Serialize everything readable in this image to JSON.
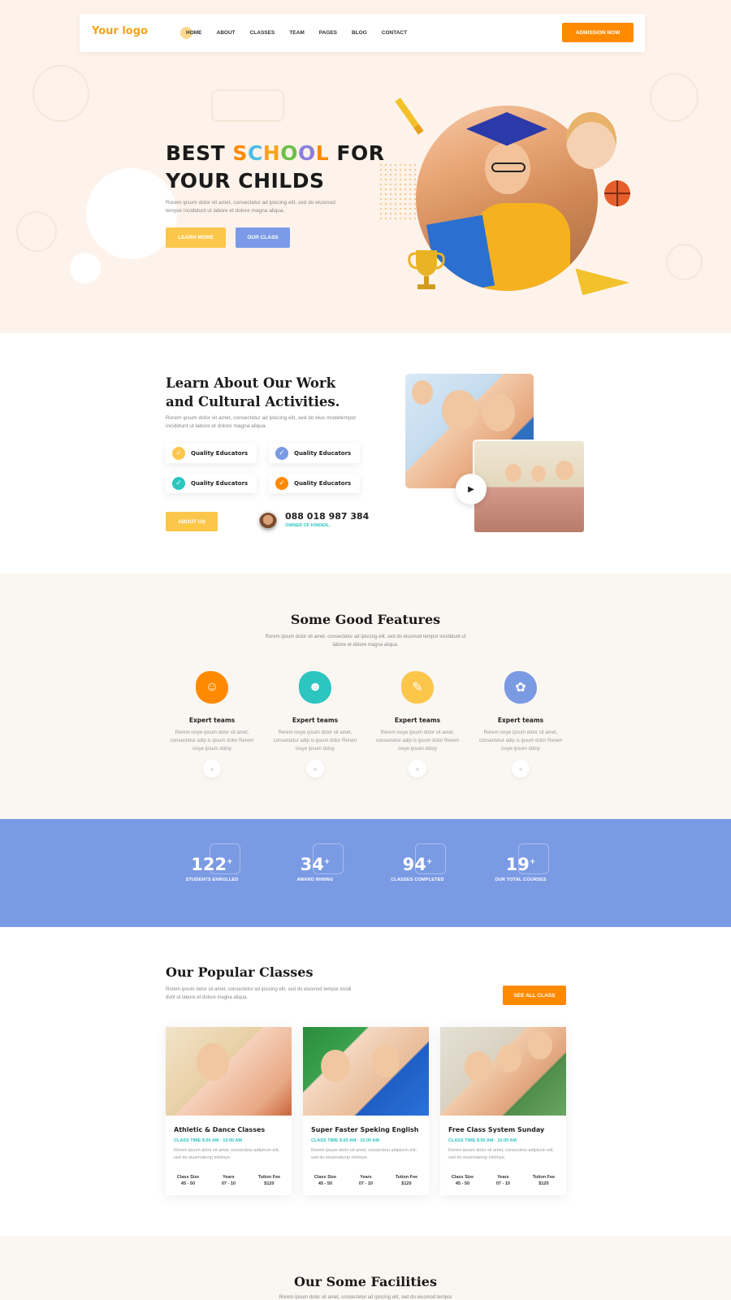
{
  "header": {
    "logo": "Your logo",
    "nav": [
      "HOME",
      "ABOUT",
      "CLASSES",
      "TEAM",
      "PAGES",
      "BLOG",
      "CONTACT"
    ],
    "admission_button": "ADMISSION NOW"
  },
  "hero": {
    "title_best": "BEST",
    "title_school": [
      "S",
      "C",
      "H",
      "O",
      "O",
      "L"
    ],
    "title_for": "FOR",
    "title_line2": "YOUR CHILDS",
    "description": "Rorem ipsum dolor sit amet, consectetur ad ipiscing elit, sed do eiusmod tempor incididunt ut labore et dolore magna aliqua.",
    "learn_more": "LEARN MORE",
    "our_class": "OUR CLASS"
  },
  "about": {
    "title": "Learn About Our Work and Cultural Activities.",
    "description": "Rorem ipsum dolor sit amet, consectetur ad ipiscing elit, sed do eius modetempor incididunt ut labore et dolore magna aliqua.",
    "qualities": [
      "Quality Educators",
      "Quality Educators",
      "Quality Educators",
      "Quality Educators"
    ],
    "check": "✓",
    "about_button": "ABOUT US",
    "phone": "088 018 987 384",
    "owner_role": "OWNER OF KINDEN..",
    "play": "▶"
  },
  "features": {
    "title": "Some Good Features",
    "subtitle": "Rorem ipsum dolor sit amet, consectetur ad ipiscing elit, sed do eiusmod tempor incididunt ut labore et dolore magna aliqua.",
    "items": [
      {
        "title": "Expert teams",
        "desc": "Rerem iosye ipsum dolor sit amet, consectetur adip is ipsum dolor Rerem iosye ipsum doloy",
        "icon": "graduate-icon",
        "color": "#ff8a00"
      },
      {
        "title": "Expert teams",
        "desc": "Rerem iosye ipsum dolor sit amet, consectetur adip is ipsum dolor Rerem iosye ipsum doloy",
        "icon": "mask-icon",
        "color": "#2cc5c0"
      },
      {
        "title": "Expert teams",
        "desc": "Rerem iosye ipsum dolor sit amet, consectetur adip is ipsum dolor Rerem iosye ipsum doloy",
        "icon": "tools-icon",
        "color": "#fcc64b"
      },
      {
        "title": "Expert teams",
        "desc": "Rerem iosye ipsum dolor sit amet, consectetur adip is ipsum dolor Rerem iosye ipsum doloy",
        "icon": "palette-icon",
        "color": "#7b9ae4"
      }
    ],
    "arrow": "»"
  },
  "stats": [
    {
      "number": "122",
      "suffix": "+",
      "label": "STUDENTS ENROLLED"
    },
    {
      "number": "34",
      "suffix": "+",
      "label": "AWARD WINING"
    },
    {
      "number": "94",
      "suffix": "+",
      "label": "CLASSES COMPLETED"
    },
    {
      "number": "19",
      "suffix": "+",
      "label": "OUR TOTAL COURSES"
    }
  ],
  "classes": {
    "title": "Our Popular Classes",
    "description": "Rorem ipsum dolor sit amet, consectetur ad ipiscing elit, sed do eiusmod tempor incidi dunt ut labore et dolore magna aliqua.",
    "see_all": "SEE ALL CLASS",
    "cards": [
      {
        "title": "Athletic & Dance Classes",
        "time": "CLASS TIME 8.00 AM - 10.00 AM",
        "desc": "Rorem ipsum dolor sit amet, consectetu adipiscin elit, sed do eiusmotemp mirimye.",
        "size_label": "Class Size",
        "size": "45 - 50",
        "years_label": "Years",
        "years": "07 - 10",
        "fee_label": "Tution Fee",
        "fee": "$120"
      },
      {
        "title": "Super Faster Speking English",
        "time": "CLASS TIME 8.00 AM - 10.00 AM",
        "desc": "Rorem ipsum dolor sit amet, consectetu adipiscin elit, sed do eiusmotemp mirimye.",
        "size_label": "Class Size",
        "size": "45 - 50",
        "years_label": "Years",
        "years": "07 - 10",
        "fee_label": "Tution Fee",
        "fee": "$120"
      },
      {
        "title": "Free Class System Sunday",
        "time": "CLASS TIME 8.00 AM - 10.00 AM",
        "desc": "Rorem ipsum dolor sit amet, consectetu adipiscin elit, sed do eiusmotemp mirimye.",
        "size_label": "Class Size",
        "size": "45 - 50",
        "years_label": "Years",
        "years": "07 - 10",
        "fee_label": "Tution Fee",
        "fee": "$120"
      }
    ]
  },
  "facilities": {
    "title": "Our Some Facilities",
    "subtitle": "Rorem ipsum dolor sit amet, consectetur ad ipiscing elit, sed do eiusmod tempor"
  }
}
